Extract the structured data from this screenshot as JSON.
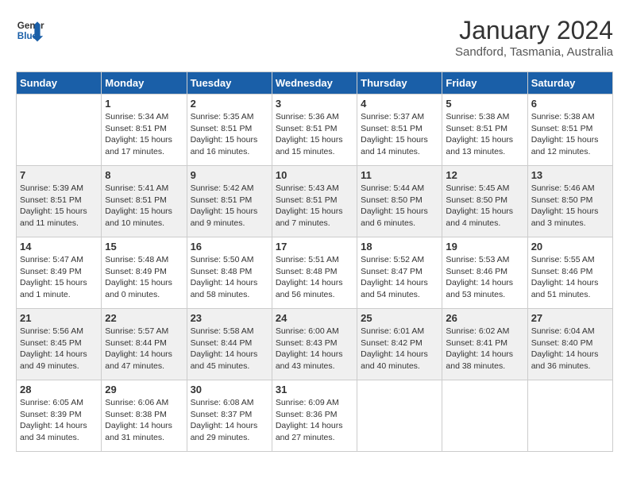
{
  "header": {
    "logo_line1": "General",
    "logo_line2": "Blue",
    "month": "January 2024",
    "location": "Sandford, Tasmania, Australia"
  },
  "weekdays": [
    "Sunday",
    "Monday",
    "Tuesday",
    "Wednesday",
    "Thursday",
    "Friday",
    "Saturday"
  ],
  "weeks": [
    [
      {
        "day": "",
        "sunrise": "",
        "sunset": "",
        "daylight": ""
      },
      {
        "day": "1",
        "sunrise": "Sunrise: 5:34 AM",
        "sunset": "Sunset: 8:51 PM",
        "daylight": "Daylight: 15 hours and 17 minutes."
      },
      {
        "day": "2",
        "sunrise": "Sunrise: 5:35 AM",
        "sunset": "Sunset: 8:51 PM",
        "daylight": "Daylight: 15 hours and 16 minutes."
      },
      {
        "day": "3",
        "sunrise": "Sunrise: 5:36 AM",
        "sunset": "Sunset: 8:51 PM",
        "daylight": "Daylight: 15 hours and 15 minutes."
      },
      {
        "day": "4",
        "sunrise": "Sunrise: 5:37 AM",
        "sunset": "Sunset: 8:51 PM",
        "daylight": "Daylight: 15 hours and 14 minutes."
      },
      {
        "day": "5",
        "sunrise": "Sunrise: 5:38 AM",
        "sunset": "Sunset: 8:51 PM",
        "daylight": "Daylight: 15 hours and 13 minutes."
      },
      {
        "day": "6",
        "sunrise": "Sunrise: 5:38 AM",
        "sunset": "Sunset: 8:51 PM",
        "daylight": "Daylight: 15 hours and 12 minutes."
      }
    ],
    [
      {
        "day": "7",
        "sunrise": "Sunrise: 5:39 AM",
        "sunset": "Sunset: 8:51 PM",
        "daylight": "Daylight: 15 hours and 11 minutes."
      },
      {
        "day": "8",
        "sunrise": "Sunrise: 5:41 AM",
        "sunset": "Sunset: 8:51 PM",
        "daylight": "Daylight: 15 hours and 10 minutes."
      },
      {
        "day": "9",
        "sunrise": "Sunrise: 5:42 AM",
        "sunset": "Sunset: 8:51 PM",
        "daylight": "Daylight: 15 hours and 9 minutes."
      },
      {
        "day": "10",
        "sunrise": "Sunrise: 5:43 AM",
        "sunset": "Sunset: 8:51 PM",
        "daylight": "Daylight: 15 hours and 7 minutes."
      },
      {
        "day": "11",
        "sunrise": "Sunrise: 5:44 AM",
        "sunset": "Sunset: 8:50 PM",
        "daylight": "Daylight: 15 hours and 6 minutes."
      },
      {
        "day": "12",
        "sunrise": "Sunrise: 5:45 AM",
        "sunset": "Sunset: 8:50 PM",
        "daylight": "Daylight: 15 hours and 4 minutes."
      },
      {
        "day": "13",
        "sunrise": "Sunrise: 5:46 AM",
        "sunset": "Sunset: 8:50 PM",
        "daylight": "Daylight: 15 hours and 3 minutes."
      }
    ],
    [
      {
        "day": "14",
        "sunrise": "Sunrise: 5:47 AM",
        "sunset": "Sunset: 8:49 PM",
        "daylight": "Daylight: 15 hours and 1 minute."
      },
      {
        "day": "15",
        "sunrise": "Sunrise: 5:48 AM",
        "sunset": "Sunset: 8:49 PM",
        "daylight": "Daylight: 15 hours and 0 minutes."
      },
      {
        "day": "16",
        "sunrise": "Sunrise: 5:50 AM",
        "sunset": "Sunset: 8:48 PM",
        "daylight": "Daylight: 14 hours and 58 minutes."
      },
      {
        "day": "17",
        "sunrise": "Sunrise: 5:51 AM",
        "sunset": "Sunset: 8:48 PM",
        "daylight": "Daylight: 14 hours and 56 minutes."
      },
      {
        "day": "18",
        "sunrise": "Sunrise: 5:52 AM",
        "sunset": "Sunset: 8:47 PM",
        "daylight": "Daylight: 14 hours and 54 minutes."
      },
      {
        "day": "19",
        "sunrise": "Sunrise: 5:53 AM",
        "sunset": "Sunset: 8:46 PM",
        "daylight": "Daylight: 14 hours and 53 minutes."
      },
      {
        "day": "20",
        "sunrise": "Sunrise: 5:55 AM",
        "sunset": "Sunset: 8:46 PM",
        "daylight": "Daylight: 14 hours and 51 minutes."
      }
    ],
    [
      {
        "day": "21",
        "sunrise": "Sunrise: 5:56 AM",
        "sunset": "Sunset: 8:45 PM",
        "daylight": "Daylight: 14 hours and 49 minutes."
      },
      {
        "day": "22",
        "sunrise": "Sunrise: 5:57 AM",
        "sunset": "Sunset: 8:44 PM",
        "daylight": "Daylight: 14 hours and 47 minutes."
      },
      {
        "day": "23",
        "sunrise": "Sunrise: 5:58 AM",
        "sunset": "Sunset: 8:44 PM",
        "daylight": "Daylight: 14 hours and 45 minutes."
      },
      {
        "day": "24",
        "sunrise": "Sunrise: 6:00 AM",
        "sunset": "Sunset: 8:43 PM",
        "daylight": "Daylight: 14 hours and 43 minutes."
      },
      {
        "day": "25",
        "sunrise": "Sunrise: 6:01 AM",
        "sunset": "Sunset: 8:42 PM",
        "daylight": "Daylight: 14 hours and 40 minutes."
      },
      {
        "day": "26",
        "sunrise": "Sunrise: 6:02 AM",
        "sunset": "Sunset: 8:41 PM",
        "daylight": "Daylight: 14 hours and 38 minutes."
      },
      {
        "day": "27",
        "sunrise": "Sunrise: 6:04 AM",
        "sunset": "Sunset: 8:40 PM",
        "daylight": "Daylight: 14 hours and 36 minutes."
      }
    ],
    [
      {
        "day": "28",
        "sunrise": "Sunrise: 6:05 AM",
        "sunset": "Sunset: 8:39 PM",
        "daylight": "Daylight: 14 hours and 34 minutes."
      },
      {
        "day": "29",
        "sunrise": "Sunrise: 6:06 AM",
        "sunset": "Sunset: 8:38 PM",
        "daylight": "Daylight: 14 hours and 31 minutes."
      },
      {
        "day": "30",
        "sunrise": "Sunrise: 6:08 AM",
        "sunset": "Sunset: 8:37 PM",
        "daylight": "Daylight: 14 hours and 29 minutes."
      },
      {
        "day": "31",
        "sunrise": "Sunrise: 6:09 AM",
        "sunset": "Sunset: 8:36 PM",
        "daylight": "Daylight: 14 hours and 27 minutes."
      },
      {
        "day": "",
        "sunrise": "",
        "sunset": "",
        "daylight": ""
      },
      {
        "day": "",
        "sunrise": "",
        "sunset": "",
        "daylight": ""
      },
      {
        "day": "",
        "sunrise": "",
        "sunset": "",
        "daylight": ""
      }
    ]
  ]
}
